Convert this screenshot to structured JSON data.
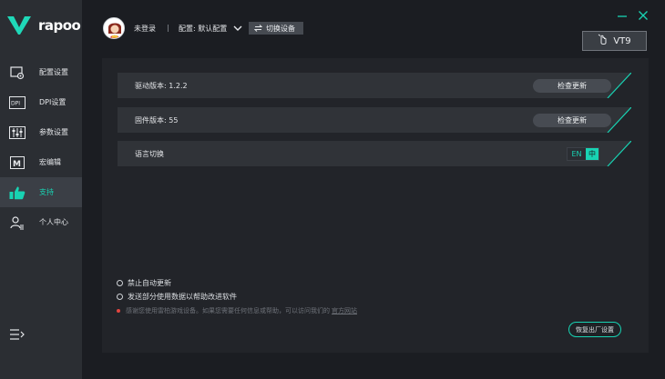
{
  "app": {
    "logo_text": "rapoo",
    "accent": "#18d3b3"
  },
  "header": {
    "login_status": "未登录",
    "separator": "|",
    "config_label": "配置: 默认配置",
    "switch_device": "切换设备",
    "device_name": "VT9"
  },
  "sidebar": {
    "items": [
      {
        "label": "配置设置",
        "icon": "config-gear-icon"
      },
      {
        "label": "DPI设置",
        "icon": "dpi-icon"
      },
      {
        "label": "参数设置",
        "icon": "sliders-icon"
      },
      {
        "label": "宏编辑",
        "icon": "macro-icon"
      },
      {
        "label": "支持",
        "icon": "thumbs-up-icon",
        "active": true
      },
      {
        "label": "个人中心",
        "icon": "user-list-icon"
      }
    ]
  },
  "support": {
    "driver_version_label": "驱动版本: 1.2.2",
    "firmware_version_label": "固件版本: 55",
    "check_update": "检查更新",
    "language_label": "语言切换",
    "lang_en": "EN",
    "lang_zh": "中",
    "opt_disable_autoupdate": "禁止自动更新",
    "opt_send_data": "发送部分使用数据以帮助改进软件",
    "notice_text": "感谢您使用雷柏游戏设备。如果您需要任何信息或帮助，可以访问我们的",
    "notice_link": "官方网站",
    "reset_button": "恢复出厂设置"
  }
}
